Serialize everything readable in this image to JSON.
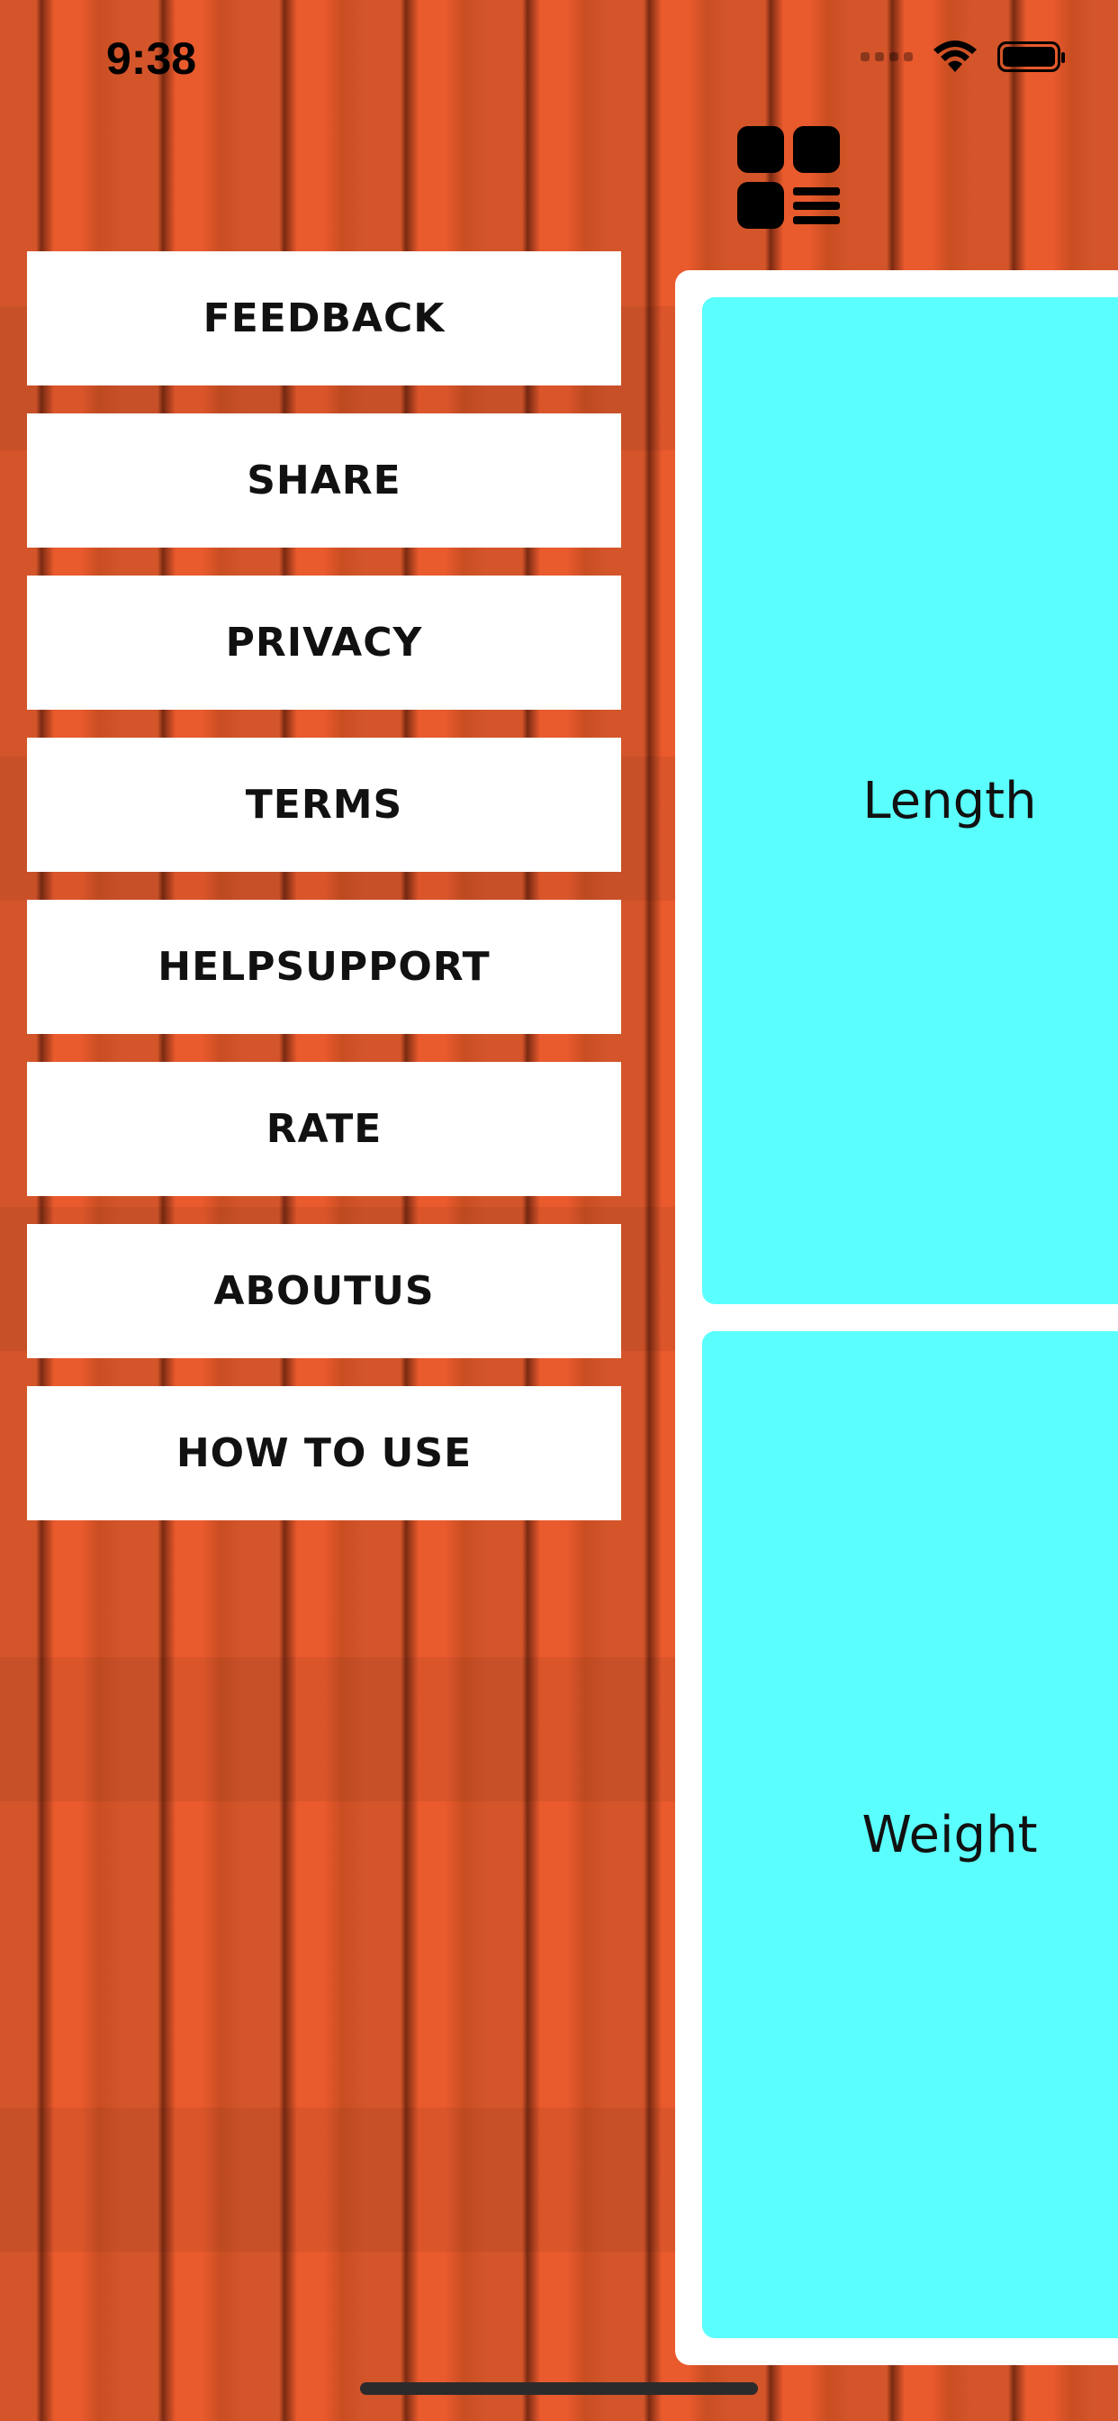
{
  "status_bar": {
    "time": "9:38",
    "icons": [
      "signal-icon",
      "wifi-icon",
      "battery-icon"
    ]
  },
  "menu_toggle": {
    "icon": "grid-list-icon"
  },
  "menu": {
    "items": [
      {
        "label": "FEEDBACK"
      },
      {
        "label": "SHARE"
      },
      {
        "label": "PRIVACY"
      },
      {
        "label": "TERMS"
      },
      {
        "label": "HELPSUPPORT"
      },
      {
        "label": "RATE"
      },
      {
        "label": "ABOUTUS"
      },
      {
        "label": "HOW TO USE"
      }
    ]
  },
  "cards": [
    {
      "label": "Length"
    },
    {
      "label": "Weight"
    }
  ],
  "colors": {
    "background": "#e55a2b",
    "card": "#5afffd",
    "button": "#ffffff",
    "text": "#111111"
  }
}
